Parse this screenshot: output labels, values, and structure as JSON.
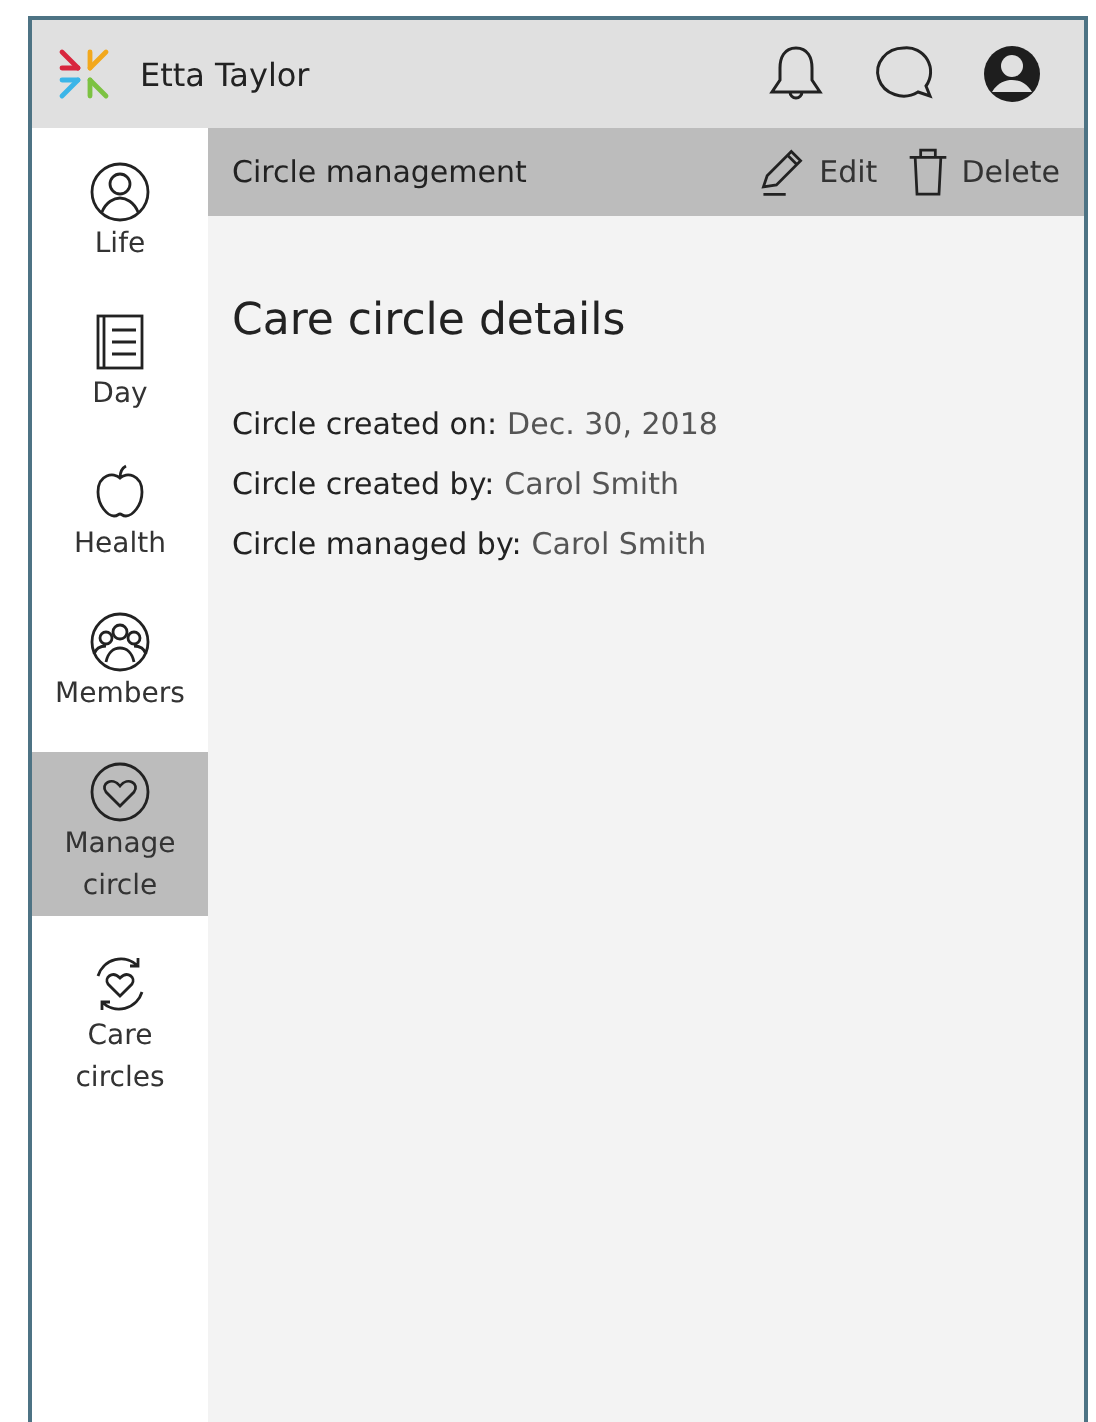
{
  "header": {
    "user_name": "Etta Taylor"
  },
  "sidebar": {
    "items": [
      {
        "label": "Life",
        "kind": "life",
        "selected": false
      },
      {
        "label": "Day",
        "kind": "day",
        "selected": false
      },
      {
        "label": "Health",
        "kind": "health",
        "selected": false
      },
      {
        "label": "Members",
        "kind": "members",
        "selected": false
      },
      {
        "label": "Manage circle",
        "kind": "manage",
        "selected": true
      },
      {
        "label": "Care circles",
        "kind": "circles",
        "selected": false
      }
    ]
  },
  "toolbar": {
    "title": "Circle management",
    "actions": [
      {
        "label": "Edit",
        "kind": "edit"
      },
      {
        "label": "Delete",
        "kind": "delete"
      }
    ]
  },
  "details": {
    "heading": "Care circle details",
    "fields": [
      {
        "label": "Circle created on:",
        "value": "Dec. 30, 2018"
      },
      {
        "label": "Circle created by:",
        "value": "Carol Smith"
      },
      {
        "label": "Circle managed by:",
        "value": "Carol Smith"
      }
    ]
  }
}
